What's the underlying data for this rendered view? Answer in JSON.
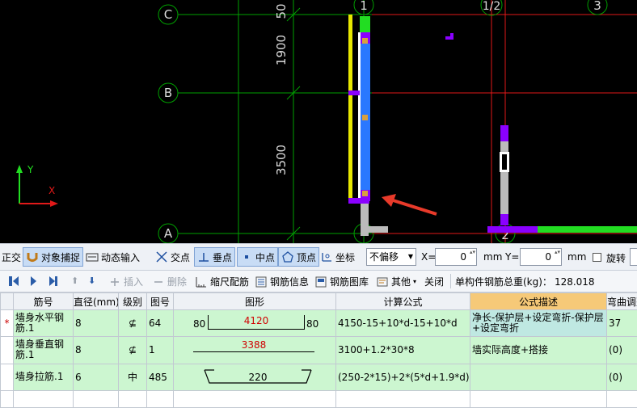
{
  "cad": {
    "axes": [
      "C",
      "B",
      "A",
      "1",
      "1/2",
      "3",
      "2"
    ],
    "dims": [
      "50",
      "1900",
      "3500"
    ],
    "ucs": {
      "x": "X",
      "y": "Y"
    }
  },
  "snapbar": {
    "ortho": "正交",
    "object_snap": "对象捕捉",
    "dynamic_input": "动态输入",
    "intersection": "交点",
    "perpendicular": "垂点",
    "midpoint": "中点",
    "vertex": "顶点",
    "coordinate": "坐标",
    "offset_mode": "不偏移",
    "x_label": "X=",
    "x_value": "0",
    "x_unit": "mm",
    "y_label": "Y=",
    "y_value": "0",
    "y_unit": "mm",
    "rotate": "旋转"
  },
  "toolbar": {
    "insert": "插入",
    "delete": "删除",
    "scale_rebar": "缩尺配筋",
    "rebar_info": "钢筋信息",
    "rebar_library": "钢筋图库",
    "other": "其他",
    "close": "关闭",
    "total_weight_label": "单构件钢筋总重(kg)：",
    "total_weight": "128.018"
  },
  "table": {
    "columns": [
      "筋号",
      "直径(mm)",
      "级别",
      "图号",
      "图形",
      "计算公式",
      "公式描述",
      "弯曲调整"
    ],
    "rows": [
      {
        "marker": "*",
        "name": "墙身水平钢筋.1",
        "diameter": "8",
        "grade": "⊈",
        "figure": "64",
        "shape_left": "80",
        "shape_mid": "4120",
        "shape_right": "80",
        "formula": "4150-15+10*d-15+10*d",
        "desc": "净长-保护层+设定弯折-保护层+设定弯折",
        "bend": "37"
      },
      {
        "marker": "",
        "name": "墙身垂直钢筋.1",
        "diameter": "8",
        "grade": "⊈",
        "figure": "1",
        "shape_left": "",
        "shape_mid": "3388",
        "shape_right": "",
        "formula": "3100+1.2*30*8",
        "desc": "墙实际高度+搭接",
        "bend": "(0)"
      },
      {
        "marker": "",
        "name": "墙身拉筋.1",
        "diameter": "6",
        "grade": "中",
        "figure": "485",
        "shape_left": "",
        "shape_mid": "220",
        "shape_right": "",
        "formula": "(250-2*15)+2*(5*d+1.9*d)",
        "desc": "",
        "bend": "(0)"
      }
    ]
  },
  "colors": {
    "grid_green": "#00a000",
    "axis_red": "#e11919",
    "wall_blue": "#2a78ff",
    "wall_yellow": "#e8e800",
    "rebar_purple": "#8a00ff",
    "row_green": "#ccf6d0",
    "header_highlight": "#f6c978"
  }
}
